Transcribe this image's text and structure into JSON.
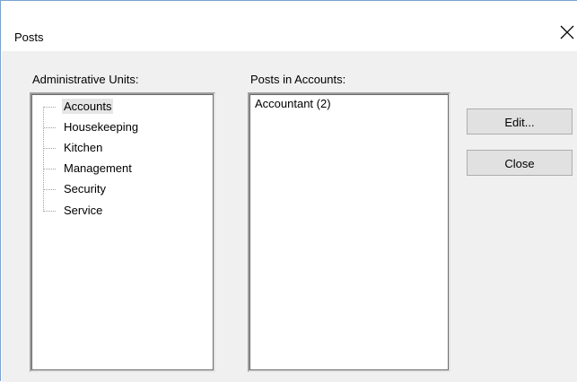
{
  "window": {
    "title": "Posts",
    "close_icon": "close-icon"
  },
  "admin_units": {
    "label": "Administrative Units:",
    "items": [
      {
        "label": "Accounts",
        "selected": true
      },
      {
        "label": "Housekeeping",
        "selected": false
      },
      {
        "label": "Kitchen",
        "selected": false
      },
      {
        "label": "Management",
        "selected": false
      },
      {
        "label": "Security",
        "selected": false
      },
      {
        "label": "Service",
        "selected": false
      }
    ]
  },
  "posts": {
    "label": "Posts in Accounts:",
    "items": [
      {
        "label": "Accountant (2)"
      }
    ]
  },
  "buttons": {
    "edit_label": "Edit...",
    "close_label": "Close"
  }
}
